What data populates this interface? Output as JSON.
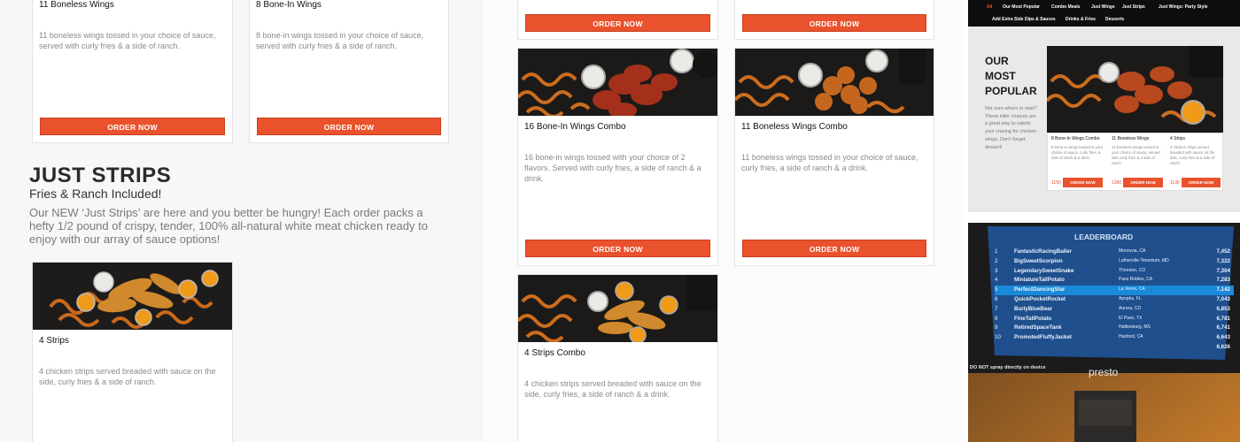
{
  "colors": {
    "accent": "#e9522c",
    "text_dark": "#111111",
    "text_muted": "#8a8a8a"
  },
  "panel1": {
    "cards": [
      {
        "title": "11 Boneless Wings",
        "desc": "11 boneless wings tossed in your choice of sauce, served with curly fries & a side of ranch.",
        "button": "ORDER NOW"
      },
      {
        "title": "8 Bone-In Wings",
        "desc": "8 bone-in wings tossed in your choice of sauce, served with curly fries & a side of ranch.",
        "button": "ORDER NOW"
      }
    ],
    "section": {
      "heading": "JUST STRIPS",
      "subheading": "Fries & Ranch Included!",
      "body": "Our NEW ‘Just Strips’ are here and you better be hungry! Each order packs a hefty 1/2 pound of crispy, tender, 100% all-natural white meat chicken ready to enjoy with our array of sauce options!"
    },
    "strips_card": {
      "title": "4 Strips",
      "desc": "4 chicken strips served breaded with sauce on the side, curly fries & a side of ranch."
    }
  },
  "panel2": {
    "top_buttons": [
      "ORDER NOW",
      "ORDER NOW"
    ],
    "cards": [
      {
        "title": "16 Bone-In Wings Combo",
        "desc": "16 bone-in wings tossed with your choice of 2 flavors. Served with curly fries, a side of ranch & a drink.",
        "button": "ORDER NOW"
      },
      {
        "title": "11 Boneless Wings Combo",
        "desc": "11 boneless wings tossed in your choice of sauce, curly fries, a side of ranch & a drink.",
        "button": "ORDER NOW"
      },
      {
        "title": "4 Strips Combo",
        "desc": "4 chicken strips served breaded with sauce on the side, curly fries, a side of ranch & a drink."
      }
    ]
  },
  "panel3": {
    "nav_row1": [
      "All",
      "Our Most Popular",
      "Combo Meals",
      "Just Wings",
      "Just Strips",
      "Just Wings: Party Style"
    ],
    "nav_row2": [
      "Add Extra Side Dips & Sauces",
      "Drinks & Fries",
      "Desserts"
    ],
    "popular_heading": [
      "OUR",
      "MOST",
      "POPULAR"
    ],
    "popular_body": "Not sure where to start? These killer choices are a great way to satisfy your craving for chicken wings. Don't forget dessert!",
    "mini_cards": [
      {
        "title": "8 Bone-In Wings Combo",
        "desc": "8 bone-in wings tossed in your choice of sauce, curly fries, a side of ranch & a drink.",
        "price": "1150",
        "button": "ORDER NOW"
      },
      {
        "title": "11 Boneless Wings",
        "desc": "11 boneless wings tossed in your choice of sauce, served with curly fries & a side of ranch.",
        "price": "1280",
        "button": "ORDER NOW"
      },
      {
        "title": "4 Strips",
        "desc": "4 chicken strips served breaded with sauce on the side, curly fries & a side of ranch.",
        "price": "1130",
        "button": "ORDER NOW"
      }
    ],
    "leaderboard": {
      "title": "LEADERBOARD",
      "rows": [
        {
          "rank": "1",
          "name": "FantasticRacingBaller",
          "loc": "Monrovia, CA",
          "score": "7,452"
        },
        {
          "rank": "2",
          "name": "BigSweetScorpion",
          "loc": "Lutherville-Timonium, MD",
          "score": "7,322"
        },
        {
          "rank": "3",
          "name": "LegendarySweetSnake",
          "loc": "Thornton, CO",
          "score": "7,304"
        },
        {
          "rank": "4",
          "name": "MiniatureTallPotato",
          "loc": "Paso Robles, CA",
          "score": "7,283"
        },
        {
          "rank": "5",
          "name": "PerfectDancingStar",
          "loc": "La Verne, CA",
          "score": "7,142"
        },
        {
          "rank": "6",
          "name": "QuickPocketRocket",
          "loc": "Apopka, FL",
          "score": "7,043"
        },
        {
          "rank": "7",
          "name": "BurlyBlueBear",
          "loc": "Aurora, CO",
          "score": "6,853"
        },
        {
          "rank": "8",
          "name": "FineTallPotato",
          "loc": "El Paso, TX",
          "score": "6,781"
        },
        {
          "rank": "9",
          "name": "RetiredSpaceTank",
          "loc": "Hattiesburg, MS",
          "score": "6,741"
        },
        {
          "rank": "10",
          "name": "PromotedFluffyJacket",
          "loc": "Hanford, CA",
          "score": "6,643"
        },
        {
          "rank": "",
          "name": "",
          "loc": "",
          "score": "6,626"
        }
      ],
      "warning": "DO NOT spray directly on device",
      "brand": "presto"
    }
  }
}
